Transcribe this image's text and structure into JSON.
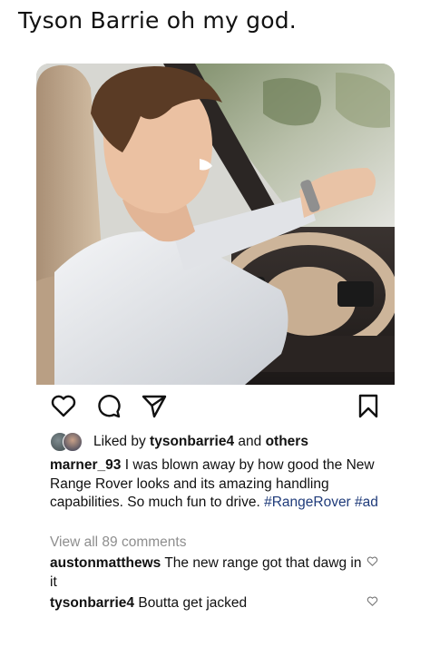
{
  "tweet": {
    "text": "Tyson Barrie oh my god."
  },
  "post": {
    "image_alt": "man driving car",
    "likes": {
      "prefix": "Liked by ",
      "user": "tysonbarrie4",
      "middle": " and ",
      "suffix": "others"
    },
    "caption": {
      "user": "marner_93",
      "text": " I was blown away by how good the New Range Rover looks and its amazing handling capabilities. So much fun to drive. ",
      "tags": [
        "#RangeRover",
        "#ad"
      ]
    },
    "view_all": "View all 89 comments",
    "comments": [
      {
        "user": "austonmatthews",
        "text": " The new range got that dawg in it"
      },
      {
        "user": "tysonbarrie4",
        "text": " Boutta get jacked"
      }
    ]
  },
  "icons": {
    "like": "heart-icon",
    "comment": "comment-icon",
    "share": "paper-plane-icon",
    "save": "bookmark-icon",
    "comment_like": "small-heart-icon"
  },
  "colors": {
    "text": "#111111",
    "muted": "#8e8e8e",
    "hashtag": "#1f3b7a"
  }
}
